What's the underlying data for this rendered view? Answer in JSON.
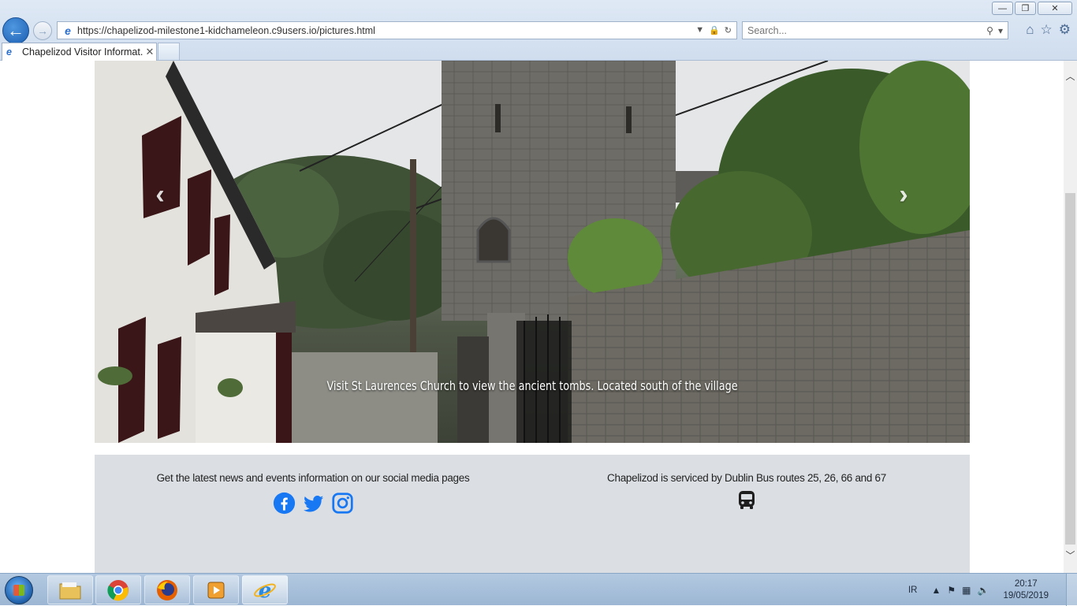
{
  "window": {
    "minimize_glyph": "—",
    "restore_glyph": "❐",
    "close_glyph": "✕"
  },
  "browser": {
    "url": "https://chapelizod-milestone1-kidchameleon.c9users.io/pictures.html",
    "search_placeholder": "Search...",
    "tab_title": "Chapelizod Visitor Informat...",
    "tab_close": "✕"
  },
  "carousel": {
    "caption": "Visit St Laurences Church to view the ancient tombs. Located south of the village",
    "prev_glyph": "‹",
    "next_glyph": "›"
  },
  "footer": {
    "social_text": "Get the latest news and events information on our social media pages",
    "bus_text": "Chapelizod is serviced by Dublin Bus routes 25, 26, 66 and 67",
    "social_color": "#1877f2"
  },
  "taskbar": {
    "ime": "IR",
    "time": "20:17",
    "date": "19/05/2019"
  }
}
